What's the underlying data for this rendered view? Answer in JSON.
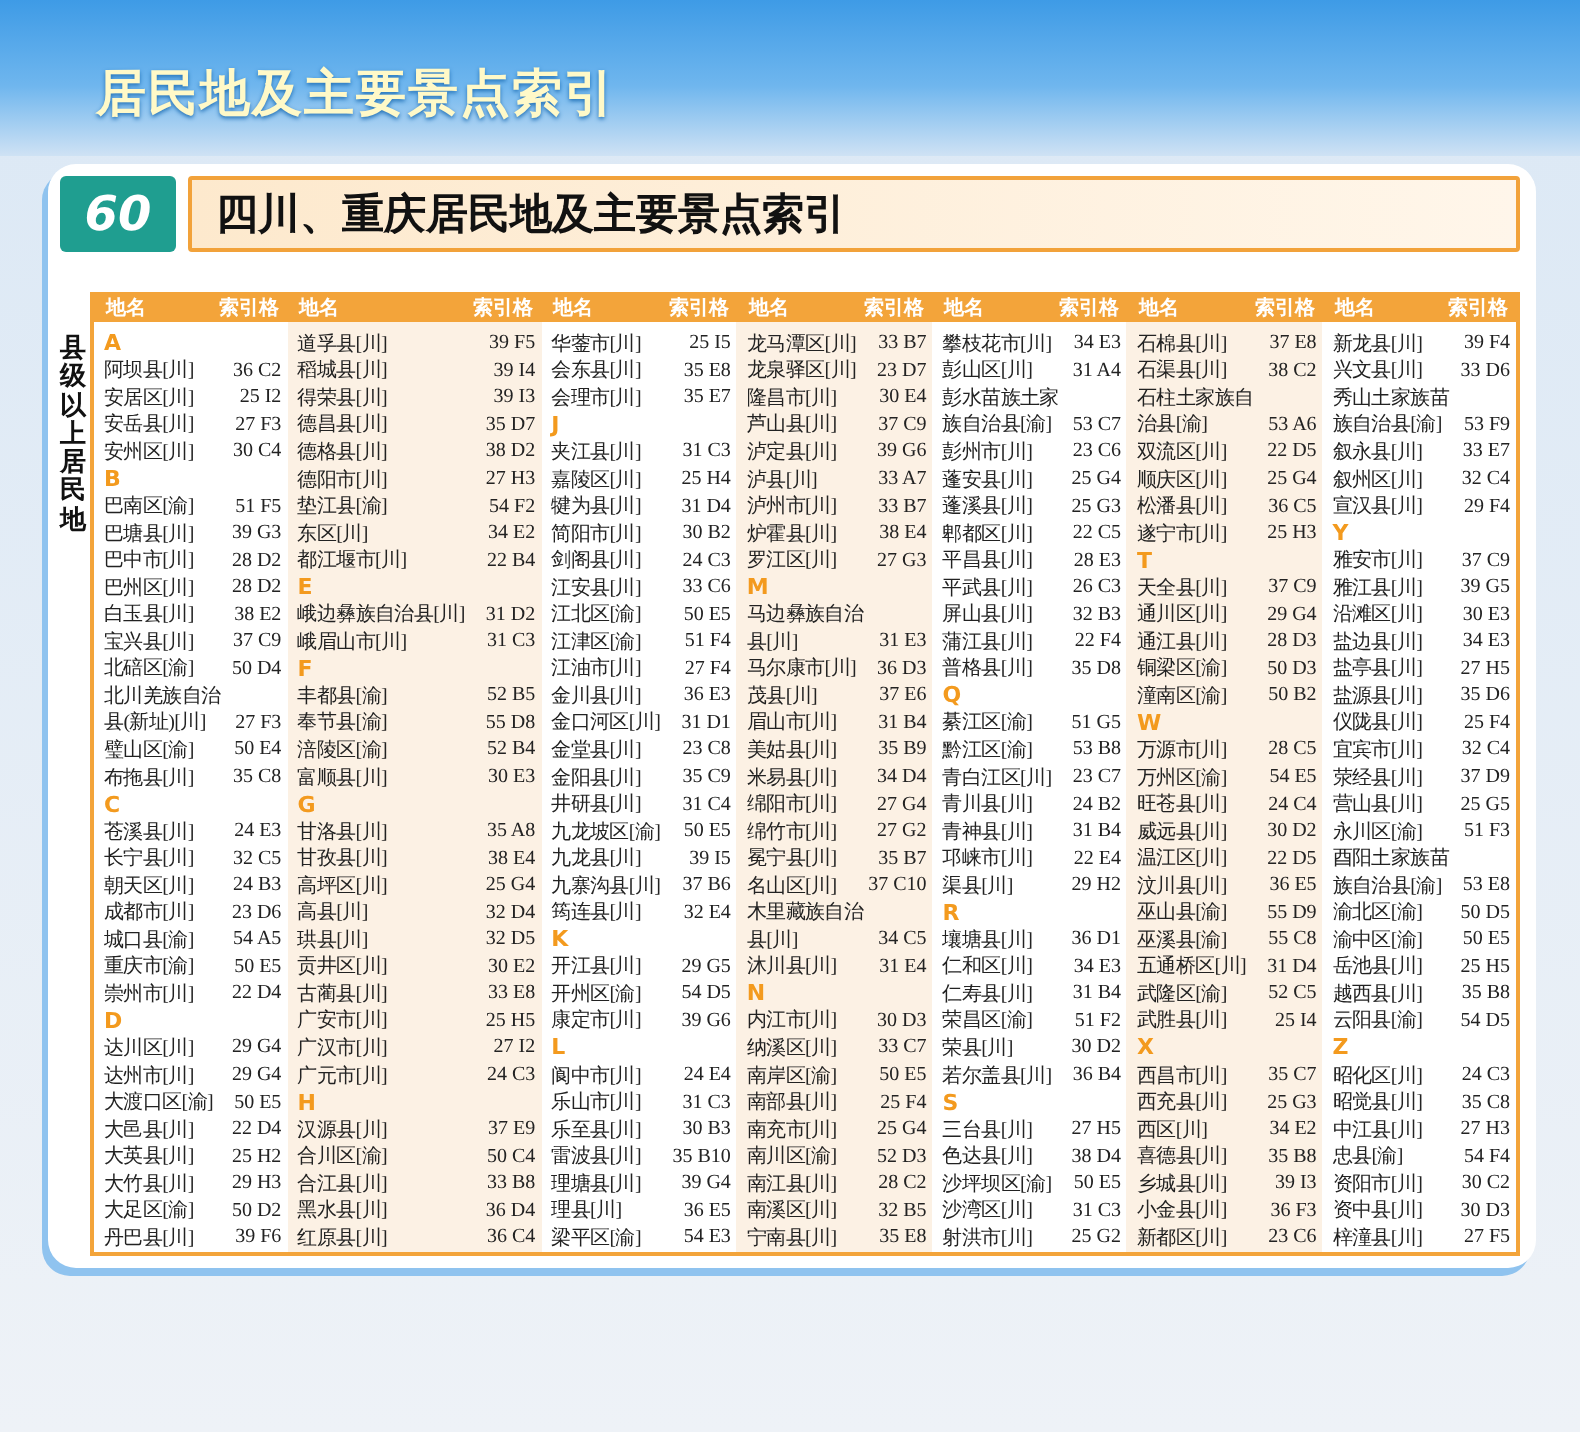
{
  "banner": {
    "title": "居民地及主要景点索引"
  },
  "page_number": "60",
  "page_title": "四川、重庆居民地及主要景点索引",
  "side_label": "县级以上居民地",
  "columns": [
    {
      "header_name": "地名",
      "header_ref": "索引格",
      "entries": [
        {
          "kind": "letter",
          "text": "A"
        },
        {
          "kind": "place",
          "name": "阿坝县[川]",
          "ref": "36 C2"
        },
        {
          "kind": "place",
          "name": "安居区[川]",
          "ref": "25 I2"
        },
        {
          "kind": "place",
          "name": "安岳县[川]",
          "ref": "27 F3"
        },
        {
          "kind": "place",
          "name": "安州区[川]",
          "ref": "30 C4"
        },
        {
          "kind": "letter",
          "text": "B"
        },
        {
          "kind": "place",
          "name": "巴南区[渝]",
          "ref": "51 F5"
        },
        {
          "kind": "place",
          "name": "巴塘县[川]",
          "ref": "39 G3"
        },
        {
          "kind": "place",
          "name": "巴中市[川]",
          "ref": "28 D2"
        },
        {
          "kind": "place",
          "name": "巴州区[川]",
          "ref": "28 D2"
        },
        {
          "kind": "place",
          "name": "白玉县[川]",
          "ref": "38 E2"
        },
        {
          "kind": "place",
          "name": "宝兴县[川]",
          "ref": "37 C9"
        },
        {
          "kind": "place",
          "name": "北碚区[渝]",
          "ref": "50 D4"
        },
        {
          "kind": "place",
          "name": "北川羌族自治"
        },
        {
          "kind": "place",
          "name": "县(新址)[川]",
          "ref": "27 F3"
        },
        {
          "kind": "place",
          "name": "璧山区[渝]",
          "ref": "50 E4"
        },
        {
          "kind": "place",
          "name": "布拖县[川]",
          "ref": "35 C8"
        },
        {
          "kind": "letter",
          "text": "C"
        },
        {
          "kind": "place",
          "name": "苍溪县[川]",
          "ref": "24 E3"
        },
        {
          "kind": "place",
          "name": "长宁县[川]",
          "ref": "32 C5"
        },
        {
          "kind": "place",
          "name": "朝天区[川]",
          "ref": "24 B3"
        },
        {
          "kind": "place",
          "name": "成都市[川]",
          "ref": "23 D6"
        },
        {
          "kind": "place",
          "name": "城口县[渝]",
          "ref": "54 A5"
        },
        {
          "kind": "place",
          "name": "重庆市[渝]",
          "ref": "50 E5"
        },
        {
          "kind": "place",
          "name": "崇州市[川]",
          "ref": "22 D4"
        },
        {
          "kind": "letter",
          "text": "D"
        },
        {
          "kind": "place",
          "name": "达川区[川]",
          "ref": "29 G4"
        },
        {
          "kind": "place",
          "name": "达州市[川]",
          "ref": "29 G4"
        },
        {
          "kind": "place",
          "name": "大渡口区[渝]",
          "ref": "50 E5"
        },
        {
          "kind": "place",
          "name": "大邑县[川]",
          "ref": "22 D4"
        },
        {
          "kind": "place",
          "name": "大英县[川]",
          "ref": "25 H2"
        },
        {
          "kind": "place",
          "name": "大竹县[川]",
          "ref": "29 H3"
        },
        {
          "kind": "place",
          "name": "大足区[渝]",
          "ref": "50 D2"
        },
        {
          "kind": "place",
          "name": "丹巴县[川]",
          "ref": "39 F6"
        }
      ]
    },
    {
      "header_name": "地名",
      "header_ref": "索引格",
      "entries": [
        {
          "kind": "place",
          "name": "道孚县[川]",
          "ref": "39 F5"
        },
        {
          "kind": "place",
          "name": "稻城县[川]",
          "ref": "39 I4"
        },
        {
          "kind": "place",
          "name": "得荣县[川]",
          "ref": "39 I3"
        },
        {
          "kind": "place",
          "name": "德昌县[川]",
          "ref": "35 D7"
        },
        {
          "kind": "place",
          "name": "德格县[川]",
          "ref": "38 D2"
        },
        {
          "kind": "place",
          "name": "德阳市[川]",
          "ref": "27 H3"
        },
        {
          "kind": "place",
          "name": "垫江县[渝]",
          "ref": "54 F2"
        },
        {
          "kind": "place",
          "name": "东区[川]",
          "ref": "34 E2"
        },
        {
          "kind": "place",
          "name": "都江堰市[川]",
          "ref": "22 B4"
        },
        {
          "kind": "letter",
          "text": "E"
        },
        {
          "kind": "place",
          "name": "峨边彝族自治县[川]",
          "ref": "31 D2"
        },
        {
          "kind": "place",
          "name": "峨眉山市[川]",
          "ref": "31 C3"
        },
        {
          "kind": "letter",
          "text": "F"
        },
        {
          "kind": "place",
          "name": "丰都县[渝]",
          "ref": "52 B5"
        },
        {
          "kind": "place",
          "name": "奉节县[渝]",
          "ref": "55 D8"
        },
        {
          "kind": "place",
          "name": "涪陵区[渝]",
          "ref": "52 B4"
        },
        {
          "kind": "place",
          "name": "富顺县[川]",
          "ref": "30 E3"
        },
        {
          "kind": "letter",
          "text": "G"
        },
        {
          "kind": "place",
          "name": "甘洛县[川]",
          "ref": "35 A8"
        },
        {
          "kind": "place",
          "name": "甘孜县[川]",
          "ref": "38 E4"
        },
        {
          "kind": "place",
          "name": "高坪区[川]",
          "ref": "25 G4"
        },
        {
          "kind": "place",
          "name": "高县[川]",
          "ref": "32 D4"
        },
        {
          "kind": "place",
          "name": "珙县[川]",
          "ref": "32 D5"
        },
        {
          "kind": "place",
          "name": "贡井区[川]",
          "ref": "30 E2"
        },
        {
          "kind": "place",
          "name": "古蔺县[川]",
          "ref": "33 E8"
        },
        {
          "kind": "place",
          "name": "广安市[川]",
          "ref": "25 H5"
        },
        {
          "kind": "place",
          "name": "广汉市[川]",
          "ref": "27 I2"
        },
        {
          "kind": "place",
          "name": "广元市[川]",
          "ref": "24 C3"
        },
        {
          "kind": "letter",
          "text": "H"
        },
        {
          "kind": "place",
          "name": "汉源县[川]",
          "ref": "37 E9"
        },
        {
          "kind": "place",
          "name": "合川区[渝]",
          "ref": "50 C4"
        },
        {
          "kind": "place",
          "name": "合江县[川]",
          "ref": "33 B8"
        },
        {
          "kind": "place",
          "name": "黑水县[川]",
          "ref": "36 D4"
        },
        {
          "kind": "place",
          "name": "红原县[川]",
          "ref": "36 C4"
        }
      ]
    },
    {
      "header_name": "地名",
      "header_ref": "索引格",
      "entries": [
        {
          "kind": "place",
          "name": "华蓥市[川]",
          "ref": "25 I5"
        },
        {
          "kind": "place",
          "name": "会东县[川]",
          "ref": "35 E8"
        },
        {
          "kind": "place",
          "name": "会理市[川]",
          "ref": "35 E7"
        },
        {
          "kind": "letter",
          "text": "J"
        },
        {
          "kind": "place",
          "name": "夹江县[川]",
          "ref": "31 C3"
        },
        {
          "kind": "place",
          "name": "嘉陵区[川]",
          "ref": "25 H4"
        },
        {
          "kind": "place",
          "name": "犍为县[川]",
          "ref": "31 D4"
        },
        {
          "kind": "place",
          "name": "简阳市[川]",
          "ref": "30 B2"
        },
        {
          "kind": "place",
          "name": "剑阁县[川]",
          "ref": "24 C3"
        },
        {
          "kind": "place",
          "name": "江安县[川]",
          "ref": "33 C6"
        },
        {
          "kind": "place",
          "name": "江北区[渝]",
          "ref": "50 E5"
        },
        {
          "kind": "place",
          "name": "江津区[渝]",
          "ref": "51 F4"
        },
        {
          "kind": "place",
          "name": "江油市[川]",
          "ref": "27 F4"
        },
        {
          "kind": "place",
          "name": "金川县[川]",
          "ref": "36 E3"
        },
        {
          "kind": "place",
          "name": "金口河区[川]",
          "ref": "31 D1"
        },
        {
          "kind": "place",
          "name": "金堂县[川]",
          "ref": "23 C8"
        },
        {
          "kind": "place",
          "name": "金阳县[川]",
          "ref": "35 C9"
        },
        {
          "kind": "place",
          "name": "井研县[川]",
          "ref": "31 C4"
        },
        {
          "kind": "place",
          "name": "九龙坡区[渝]",
          "ref": "50 E5"
        },
        {
          "kind": "place",
          "name": "九龙县[川]",
          "ref": "39 I5"
        },
        {
          "kind": "place",
          "name": "九寨沟县[川]",
          "ref": "37 B6"
        },
        {
          "kind": "place",
          "name": "筠连县[川]",
          "ref": "32 E4"
        },
        {
          "kind": "letter",
          "text": "K"
        },
        {
          "kind": "place",
          "name": "开江县[川]",
          "ref": "29 G5"
        },
        {
          "kind": "place",
          "name": "开州区[渝]",
          "ref": "54 D5"
        },
        {
          "kind": "place",
          "name": "康定市[川]",
          "ref": "39 G6"
        },
        {
          "kind": "letter",
          "text": "L"
        },
        {
          "kind": "place",
          "name": "阆中市[川]",
          "ref": "24 E4"
        },
        {
          "kind": "place",
          "name": "乐山市[川]",
          "ref": "31 C3"
        },
        {
          "kind": "place",
          "name": "乐至县[川]",
          "ref": "30 B3"
        },
        {
          "kind": "place",
          "name": "雷波县[川]",
          "ref": "35 B10"
        },
        {
          "kind": "place",
          "name": "理塘县[川]",
          "ref": "39 G4"
        },
        {
          "kind": "place",
          "name": "理县[川]",
          "ref": "36 E5"
        },
        {
          "kind": "place",
          "name": "梁平区[渝]",
          "ref": "54 E3"
        }
      ]
    },
    {
      "header_name": "地名",
      "header_ref": "索引格",
      "entries": [
        {
          "kind": "place",
          "name": "龙马潭区[川]",
          "ref": "33 B7"
        },
        {
          "kind": "place",
          "name": "龙泉驿区[川]",
          "ref": "23 D7"
        },
        {
          "kind": "place",
          "name": "隆昌市[川]",
          "ref": "30 E4"
        },
        {
          "kind": "place",
          "name": "芦山县[川]",
          "ref": "37 C9"
        },
        {
          "kind": "place",
          "name": "泸定县[川]",
          "ref": "39 G6"
        },
        {
          "kind": "place",
          "name": "泸县[川]",
          "ref": "33 A7"
        },
        {
          "kind": "place",
          "name": "泸州市[川]",
          "ref": "33 B7"
        },
        {
          "kind": "place",
          "name": "炉霍县[川]",
          "ref": "38 E4"
        },
        {
          "kind": "place",
          "name": "罗江区[川]",
          "ref": "27 G3"
        },
        {
          "kind": "letter",
          "text": "M"
        },
        {
          "kind": "place",
          "name": "马边彝族自治"
        },
        {
          "kind": "place",
          "name": "县[川]",
          "ref": "31 E3"
        },
        {
          "kind": "place",
          "name": "马尔康市[川]",
          "ref": "36 D3"
        },
        {
          "kind": "place",
          "name": "茂县[川]",
          "ref": "37 E6"
        },
        {
          "kind": "place",
          "name": "眉山市[川]",
          "ref": "31 B4"
        },
        {
          "kind": "place",
          "name": "美姑县[川]",
          "ref": "35 B9"
        },
        {
          "kind": "place",
          "name": "米易县[川]",
          "ref": "34 D4"
        },
        {
          "kind": "place",
          "name": "绵阳市[川]",
          "ref": "27 G4"
        },
        {
          "kind": "place",
          "name": "绵竹市[川]",
          "ref": "27 G2"
        },
        {
          "kind": "place",
          "name": "冕宁县[川]",
          "ref": "35 B7"
        },
        {
          "kind": "place",
          "name": "名山区[川]",
          "ref": "37 C10"
        },
        {
          "kind": "place",
          "name": "木里藏族自治"
        },
        {
          "kind": "place",
          "name": "县[川]",
          "ref": "34 C5"
        },
        {
          "kind": "place",
          "name": "沐川县[川]",
          "ref": "31 E4"
        },
        {
          "kind": "letter",
          "text": "N"
        },
        {
          "kind": "place",
          "name": "内江市[川]",
          "ref": "30 D3"
        },
        {
          "kind": "place",
          "name": "纳溪区[川]",
          "ref": "33 C7"
        },
        {
          "kind": "place",
          "name": "南岸区[渝]",
          "ref": "50 E5"
        },
        {
          "kind": "place",
          "name": "南部县[川]",
          "ref": "25 F4"
        },
        {
          "kind": "place",
          "name": "南充市[川]",
          "ref": "25 G4"
        },
        {
          "kind": "place",
          "name": "南川区[渝]",
          "ref": "52 D3"
        },
        {
          "kind": "place",
          "name": "南江县[川]",
          "ref": "28 C2"
        },
        {
          "kind": "place",
          "name": "南溪区[川]",
          "ref": "32 B5"
        },
        {
          "kind": "place",
          "name": "宁南县[川]",
          "ref": "35 E8"
        }
      ]
    },
    {
      "header_name": "地名",
      "header_ref": "索引格",
      "entries": [
        {
          "kind": "place",
          "name": "攀枝花市[川]",
          "ref": "34 E3"
        },
        {
          "kind": "place",
          "name": "彭山区[川]",
          "ref": "31 A4"
        },
        {
          "kind": "place",
          "name": "彭水苗族土家"
        },
        {
          "kind": "place",
          "name": "族自治县[渝]",
          "ref": "53 C7"
        },
        {
          "kind": "place",
          "name": "彭州市[川]",
          "ref": "23 C6"
        },
        {
          "kind": "place",
          "name": "蓬安县[川]",
          "ref": "25 G4"
        },
        {
          "kind": "place",
          "name": "蓬溪县[川]",
          "ref": "25 G3"
        },
        {
          "kind": "place",
          "name": "郫都区[川]",
          "ref": "22 C5"
        },
        {
          "kind": "place",
          "name": "平昌县[川]",
          "ref": "28 E3"
        },
        {
          "kind": "place",
          "name": "平武县[川]",
          "ref": "26 C3"
        },
        {
          "kind": "place",
          "name": "屏山县[川]",
          "ref": "32 B3"
        },
        {
          "kind": "place",
          "name": "蒲江县[川]",
          "ref": "22 F4"
        },
        {
          "kind": "place",
          "name": "普格县[川]",
          "ref": "35 D8"
        },
        {
          "kind": "letter",
          "text": "Q"
        },
        {
          "kind": "place",
          "name": "綦江区[渝]",
          "ref": "51 G5"
        },
        {
          "kind": "place",
          "name": "黔江区[渝]",
          "ref": "53 B8"
        },
        {
          "kind": "place",
          "name": "青白江区[川]",
          "ref": "23 C7"
        },
        {
          "kind": "place",
          "name": "青川县[川]",
          "ref": "24 B2"
        },
        {
          "kind": "place",
          "name": "青神县[川]",
          "ref": "31 B4"
        },
        {
          "kind": "place",
          "name": "邛崃市[川]",
          "ref": "22 E4"
        },
        {
          "kind": "place",
          "name": "渠县[川]",
          "ref": "29 H2"
        },
        {
          "kind": "letter",
          "text": "R"
        },
        {
          "kind": "place",
          "name": "壤塘县[川]",
          "ref": "36 D1"
        },
        {
          "kind": "place",
          "name": "仁和区[川]",
          "ref": "34 E3"
        },
        {
          "kind": "place",
          "name": "仁寿县[川]",
          "ref": "31 B4"
        },
        {
          "kind": "place",
          "name": "荣昌区[渝]",
          "ref": "51 F2"
        },
        {
          "kind": "place",
          "name": "荣县[川]",
          "ref": "30 D2"
        },
        {
          "kind": "place",
          "name": "若尔盖县[川]",
          "ref": "36 B4"
        },
        {
          "kind": "letter",
          "text": "S"
        },
        {
          "kind": "place",
          "name": "三台县[川]",
          "ref": "27 H5"
        },
        {
          "kind": "place",
          "name": "色达县[川]",
          "ref": "38 D4"
        },
        {
          "kind": "place",
          "name": "沙坪坝区[渝]",
          "ref": "50 E5"
        },
        {
          "kind": "place",
          "name": "沙湾区[川]",
          "ref": "31 C3"
        },
        {
          "kind": "place",
          "name": "射洪市[川]",
          "ref": "25 G2"
        }
      ]
    },
    {
      "header_name": "地名",
      "header_ref": "索引格",
      "entries": [
        {
          "kind": "place",
          "name": "石棉县[川]",
          "ref": "37 E8"
        },
        {
          "kind": "place",
          "name": "石渠县[川]",
          "ref": "38 C2"
        },
        {
          "kind": "place",
          "name": "石柱土家族自"
        },
        {
          "kind": "place",
          "name": "治县[渝]",
          "ref": "53 A6"
        },
        {
          "kind": "place",
          "name": "双流区[川]",
          "ref": "22 D5"
        },
        {
          "kind": "place",
          "name": "顺庆区[川]",
          "ref": "25 G4"
        },
        {
          "kind": "place",
          "name": "松潘县[川]",
          "ref": "36 C5"
        },
        {
          "kind": "place",
          "name": "遂宁市[川]",
          "ref": "25 H3"
        },
        {
          "kind": "letter",
          "text": "T"
        },
        {
          "kind": "place",
          "name": "天全县[川]",
          "ref": "37 C9"
        },
        {
          "kind": "place",
          "name": "通川区[川]",
          "ref": "29 G4"
        },
        {
          "kind": "place",
          "name": "通江县[川]",
          "ref": "28 D3"
        },
        {
          "kind": "place",
          "name": "铜梁区[渝]",
          "ref": "50 D3"
        },
        {
          "kind": "place",
          "name": "潼南区[渝]",
          "ref": "50 B2"
        },
        {
          "kind": "letter",
          "text": "W"
        },
        {
          "kind": "place",
          "name": "万源市[川]",
          "ref": "28 C5"
        },
        {
          "kind": "place",
          "name": "万州区[渝]",
          "ref": "54 E5"
        },
        {
          "kind": "place",
          "name": "旺苍县[川]",
          "ref": "24 C4"
        },
        {
          "kind": "place",
          "name": "威远县[川]",
          "ref": "30 D2"
        },
        {
          "kind": "place",
          "name": "温江区[川]",
          "ref": "22 D5"
        },
        {
          "kind": "place",
          "name": "汶川县[川]",
          "ref": "36 E5"
        },
        {
          "kind": "place",
          "name": "巫山县[渝]",
          "ref": "55 D9"
        },
        {
          "kind": "place",
          "name": "巫溪县[渝]",
          "ref": "55 C8"
        },
        {
          "kind": "place",
          "name": "五通桥区[川]",
          "ref": "31 D4"
        },
        {
          "kind": "place",
          "name": "武隆区[渝]",
          "ref": "52 C5"
        },
        {
          "kind": "place",
          "name": "武胜县[川]",
          "ref": "25 I4"
        },
        {
          "kind": "letter",
          "text": "X"
        },
        {
          "kind": "place",
          "name": "西昌市[川]",
          "ref": "35 C7"
        },
        {
          "kind": "place",
          "name": "西充县[川]",
          "ref": "25 G3"
        },
        {
          "kind": "place",
          "name": "西区[川]",
          "ref": "34 E2"
        },
        {
          "kind": "place",
          "name": "喜德县[川]",
          "ref": "35 B8"
        },
        {
          "kind": "place",
          "name": "乡城县[川]",
          "ref": "39 I3"
        },
        {
          "kind": "place",
          "name": "小金县[川]",
          "ref": "36 F3"
        },
        {
          "kind": "place",
          "name": "新都区[川]",
          "ref": "23 C6"
        }
      ]
    },
    {
      "header_name": "地名",
      "header_ref": "索引格",
      "entries": [
        {
          "kind": "place",
          "name": "新龙县[川]",
          "ref": "39 F4"
        },
        {
          "kind": "place",
          "name": "兴文县[川]",
          "ref": "33 D6"
        },
        {
          "kind": "place",
          "name": "秀山土家族苗"
        },
        {
          "kind": "place",
          "name": "族自治县[渝]",
          "ref": "53 F9"
        },
        {
          "kind": "place",
          "name": "叙永县[川]",
          "ref": "33 E7"
        },
        {
          "kind": "place",
          "name": "叙州区[川]",
          "ref": "32 C4"
        },
        {
          "kind": "place",
          "name": "宣汉县[川]",
          "ref": "29 F4"
        },
        {
          "kind": "letter",
          "text": "Y"
        },
        {
          "kind": "place",
          "name": "雅安市[川]",
          "ref": "37 C9"
        },
        {
          "kind": "place",
          "name": "雅江县[川]",
          "ref": "39 G5"
        },
        {
          "kind": "place",
          "name": "沿滩区[川]",
          "ref": "30 E3"
        },
        {
          "kind": "place",
          "name": "盐边县[川]",
          "ref": "34 E3"
        },
        {
          "kind": "place",
          "name": "盐亭县[川]",
          "ref": "27 H5"
        },
        {
          "kind": "place",
          "name": "盐源县[川]",
          "ref": "35 D6"
        },
        {
          "kind": "place",
          "name": "仪陇县[川]",
          "ref": "25 F4"
        },
        {
          "kind": "place",
          "name": "宜宾市[川]",
          "ref": "32 C4"
        },
        {
          "kind": "place",
          "name": "荥经县[川]",
          "ref": "37 D9"
        },
        {
          "kind": "place",
          "name": "营山县[川]",
          "ref": "25 G5"
        },
        {
          "kind": "place",
          "name": "永川区[渝]",
          "ref": "51 F3"
        },
        {
          "kind": "place",
          "name": "酉阳土家族苗"
        },
        {
          "kind": "place",
          "name": "族自治县[渝]",
          "ref": "53 E8"
        },
        {
          "kind": "place",
          "name": "渝北区[渝]",
          "ref": "50 D5"
        },
        {
          "kind": "place",
          "name": "渝中区[渝]",
          "ref": "50 E5"
        },
        {
          "kind": "place",
          "name": "岳池县[川]",
          "ref": "25 H5"
        },
        {
          "kind": "place",
          "name": "越西县[川]",
          "ref": "35 B8"
        },
        {
          "kind": "place",
          "name": "云阳县[渝]",
          "ref": "54 D5"
        },
        {
          "kind": "letter",
          "text": "Z"
        },
        {
          "kind": "place",
          "name": "昭化区[川]",
          "ref": "24 C3"
        },
        {
          "kind": "place",
          "name": "昭觉县[川]",
          "ref": "35 C8"
        },
        {
          "kind": "place",
          "name": "中江县[川]",
          "ref": "27 H3"
        },
        {
          "kind": "place",
          "name": "忠县[渝]",
          "ref": "54 F4"
        },
        {
          "kind": "place",
          "name": "资阳市[川]",
          "ref": "30 C2"
        },
        {
          "kind": "place",
          "name": "资中县[川]",
          "ref": "30 D3"
        },
        {
          "kind": "place",
          "name": "梓潼县[川]",
          "ref": "27 F5"
        }
      ]
    }
  ]
}
